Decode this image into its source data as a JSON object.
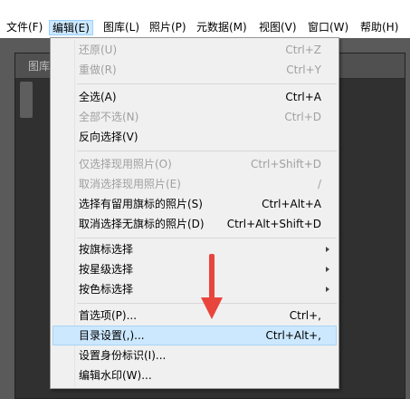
{
  "menubar": {
    "items": [
      {
        "label": "文件(F)"
      },
      {
        "label": "编辑(E)"
      },
      {
        "label": "图库(L)"
      },
      {
        "label": "照片(P)"
      },
      {
        "label": "元数据(M)"
      },
      {
        "label": "视图(V)"
      },
      {
        "label": "窗口(W)"
      },
      {
        "label": "帮助(H)"
      }
    ]
  },
  "background": {
    "panel_title": "图库"
  },
  "edit_menu": {
    "undo": {
      "label": "还原(U)",
      "shortcut": "Ctrl+Z"
    },
    "redo": {
      "label": "重做(R)",
      "shortcut": "Ctrl+Y"
    },
    "select_all": {
      "label": "全选(A)",
      "shortcut": "Ctrl+A"
    },
    "select_none": {
      "label": "全部不选(N)",
      "shortcut": "Ctrl+D"
    },
    "invert_selection": {
      "label": "反向选择(V)"
    },
    "select_active_only": {
      "label": "仅选择现用照片(O)",
      "shortcut": "Ctrl+Shift+D"
    },
    "deselect_active": {
      "label": "取消选择现用照片(E)",
      "shortcut": "/"
    },
    "select_flagged": {
      "label": "选择有留用旗标的照片(S)",
      "shortcut": "Ctrl+Alt+A"
    },
    "deselect_unflagged": {
      "label": "取消选择无旗标的照片(D)",
      "shortcut": "Ctrl+Alt+Shift+D"
    },
    "select_by_flag": {
      "label": "按旗标选择"
    },
    "select_by_rating": {
      "label": "按星级选择"
    },
    "select_by_color": {
      "label": "按色标选择"
    },
    "preferences": {
      "label": "首选项(P)...",
      "shortcut": "Ctrl+,"
    },
    "catalog_settings": {
      "label": "目录设置(,)...",
      "shortcut": "Ctrl+Alt+,"
    },
    "identity_plate": {
      "label": "设置身份标识(I)..."
    },
    "watermarks": {
      "label": "编辑水印(W)..."
    }
  },
  "colors": {
    "highlight": "#cce8ff",
    "annotation_arrow": "#e8453c"
  }
}
